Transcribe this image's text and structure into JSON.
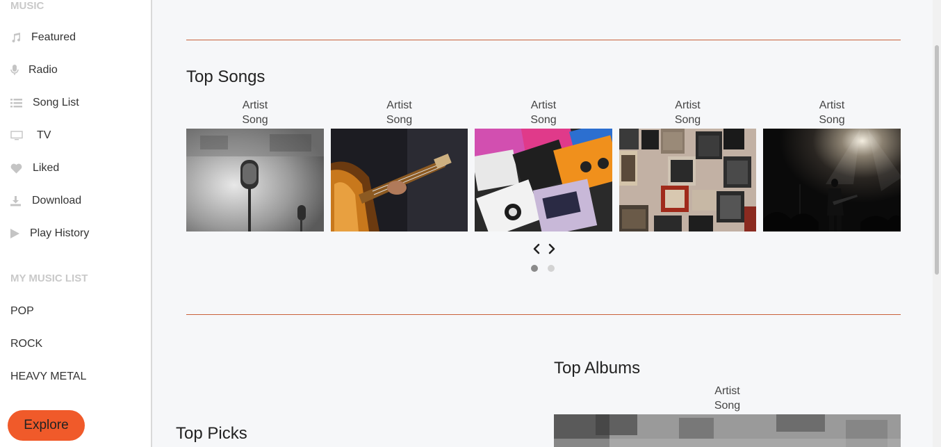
{
  "sidebar": {
    "music_title": "MUSIC",
    "items": [
      {
        "label": "Featured",
        "icon": "music-note-icon"
      },
      {
        "label": "Radio",
        "icon": "microphone-icon"
      },
      {
        "label": "Song List",
        "icon": "list-icon"
      },
      {
        "label": "TV",
        "icon": "monitor-icon"
      },
      {
        "label": "Liked",
        "icon": "heart-icon"
      },
      {
        "label": "Download",
        "icon": "download-icon"
      },
      {
        "label": "Play History",
        "icon": "play-icon"
      }
    ],
    "my_list_title": "MY MUSIC LIST",
    "lists": [
      "POP",
      "ROCK",
      "HEAVY METAL"
    ],
    "explore_label": "Explore"
  },
  "top_songs": {
    "title": "Top Songs",
    "cards": [
      {
        "artist": "Artist",
        "song": "Song",
        "image": "vintage microphone"
      },
      {
        "artist": "Artist",
        "song": "Song",
        "image": "electric bass guitar"
      },
      {
        "artist": "Artist",
        "song": "Song",
        "image": "cassette tapes"
      },
      {
        "artist": "Artist",
        "song": "Song",
        "image": "wall of amplifiers"
      },
      {
        "artist": "Artist",
        "song": "Song",
        "image": "guitarist on stage"
      }
    ],
    "pages": 2,
    "active_page": 1
  },
  "top_albums": {
    "title": "Top Albums",
    "artist": "Artist",
    "song": "Song"
  },
  "top_picks": {
    "title": "Top Picks"
  },
  "colors": {
    "accent": "#f05a2a",
    "divider": "#c8603a"
  }
}
